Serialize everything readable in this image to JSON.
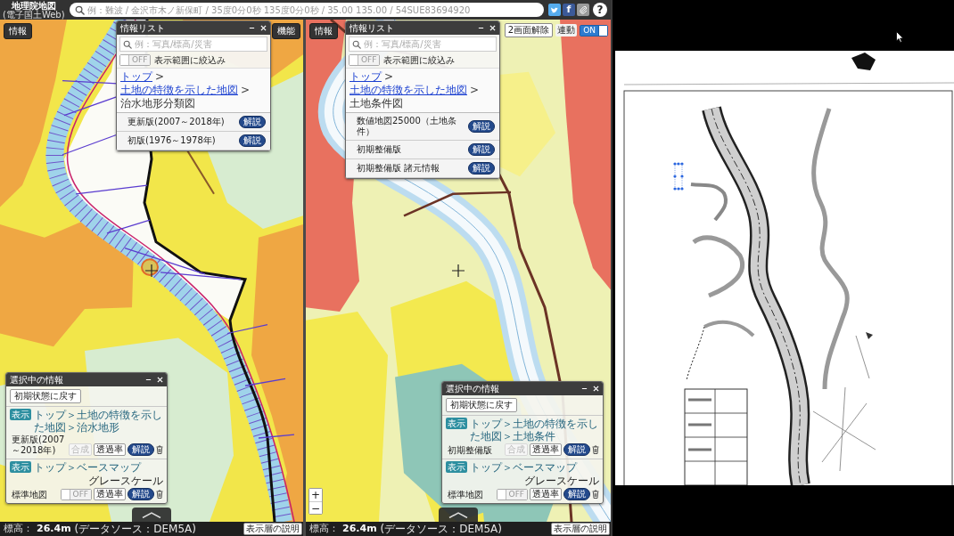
{
  "header": {
    "logo": {
      "title": "地理院地図",
      "subtitle": "(電子国土Web)"
    },
    "search": {
      "placeholder": "例：難波 / 金沢市木ノ新保町 / 35度0分0秒 135度0分0秒 / 35.00 135.00 / 54SUE83694920"
    },
    "share": [
      {
        "kind": "twitter"
      },
      {
        "kind": "facebook",
        "label": "f"
      },
      {
        "kind": "link"
      }
    ],
    "help": {
      "label": "?"
    }
  },
  "panes": [
    {
      "info_button": "情報",
      "top_right": [
        {
          "kind": "menu_button",
          "label": "機能"
        }
      ],
      "info_list": {
        "title": "情報リスト",
        "search": {
          "placeholder": "例：写真/標高/災害"
        },
        "filter": {
          "toggle": "OFF",
          "on": false,
          "label": "表示範囲に絞込み"
        },
        "breadcrumb": [
          {
            "kind": "link",
            "label": "トップ"
          },
          {
            "kind": "separator",
            "label": ">"
          },
          {
            "kind": "link",
            "label": "土地の特徴を示した地図"
          },
          {
            "kind": "separator",
            "label": ">"
          },
          {
            "kind": "current",
            "label": "治水地形分類図"
          }
        ],
        "items": [
          {
            "label": "更新版(2007～2018年)",
            "button": "解説"
          },
          {
            "label": "初版(1976～1978年)",
            "button": "解説"
          }
        ]
      },
      "selected_info": {
        "title": "選択中の情報",
        "reset_button": "初期状態に戻す",
        "layers": [
          {
            "kind": "overlay",
            "badge": "表示",
            "path": "トップ＞土地の特徴を示した地図＞治水地形",
            "title": "更新版(2007～2018年)",
            "composite": {
              "label": "合成",
              "disabled": true
            },
            "opacity_button": "透過率",
            "info_button": "解説"
          },
          {
            "kind": "base",
            "badge": "表示",
            "path": "トップ＞ベースマップ",
            "title": "標準地図",
            "grayscale": {
              "label": "グレースケール",
              "toggle": "OFF",
              "on": false
            },
            "opacity_button": "透過率",
            "info_button": "解説"
          }
        ]
      },
      "status": {
        "elevation_label": "標高：",
        "elevation_value": "26.4m",
        "source": "(データソース：DEM5A)"
      },
      "legend_button": "表示層の説明"
    },
    {
      "info_button": "情報",
      "top_right": [
        {
          "kind": "button",
          "label": "2画面解除"
        },
        {
          "kind": "label",
          "label": "連動"
        },
        {
          "kind": "toggle",
          "label": "ON",
          "on": true
        }
      ],
      "info_list": {
        "title": "情報リスト",
        "search": {
          "placeholder": "例：写真/標高/災害"
        },
        "filter": {
          "toggle": "OFF",
          "on": false,
          "label": "表示範囲に絞込み"
        },
        "breadcrumb": [
          {
            "kind": "link",
            "label": "トップ"
          },
          {
            "kind": "separator",
            "label": ">"
          },
          {
            "kind": "link",
            "label": "土地の特徴を示した地図"
          },
          {
            "kind": "separator",
            "label": ">"
          },
          {
            "kind": "current",
            "label": "土地条件図"
          }
        ],
        "items": [
          {
            "label": "数値地図25000（土地条件）",
            "button": "解説"
          },
          {
            "label": "初期整備版",
            "button": "解説"
          },
          {
            "label": "初期整備版 諸元情報",
            "button": "解説"
          }
        ]
      },
      "selected_info": {
        "title": "選択中の情報",
        "reset_button": "初期状態に戻す",
        "layers": [
          {
            "kind": "overlay",
            "badge": "表示",
            "path": "トップ＞土地の特徴を示した地図＞土地条件",
            "title": "初期整備版",
            "composite": {
              "label": "合成",
              "disabled": true
            },
            "opacity_button": "透過率",
            "info_button": "解説"
          },
          {
            "kind": "base",
            "badge": "表示",
            "path": "トップ＞ベースマップ",
            "title": "標準地図",
            "grayscale": {
              "label": "グレースケール",
              "toggle": "OFF",
              "on": false
            },
            "opacity_button": "透過率",
            "info_button": "解説"
          }
        ]
      },
      "zoom": {
        "zoom_in": "+",
        "zoom_out": "−"
      },
      "status": {
        "elevation_label": "標高：",
        "elevation_value": "26.4m",
        "source": "(データソース：DEM5A)"
      },
      "legend_button": "表示層の説明"
    }
  ]
}
